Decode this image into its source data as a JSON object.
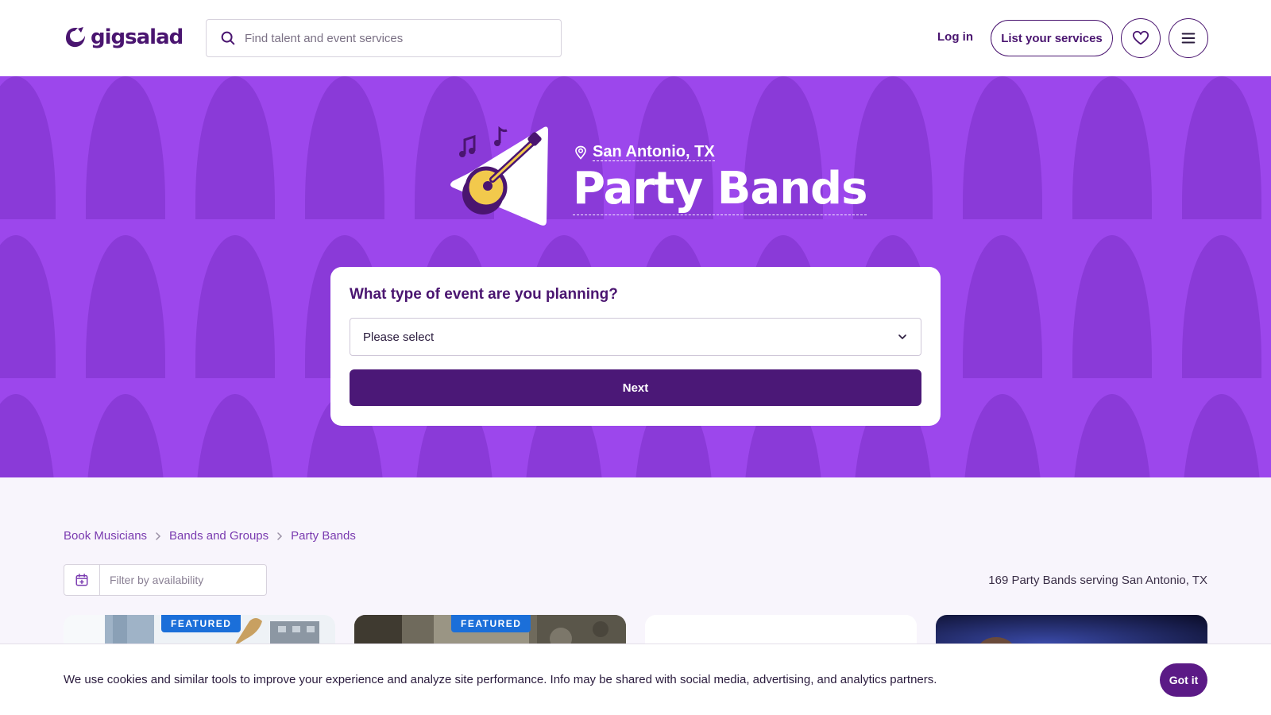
{
  "header": {
    "logo_text": "gigsalad",
    "search_placeholder": "Find talent and event services",
    "login_label": "Log in",
    "list_services_label": "List your services",
    "favorites_icon": "heart-icon",
    "menu_icon": "hamburger-menu-icon"
  },
  "hero": {
    "location": "San Antonio, TX",
    "title": "Party Bands",
    "illustration_icon": "guitar-illustration",
    "background_color": "#9c47ec",
    "event_form": {
      "question": "What type of event are you planning?",
      "select_value": "Please select",
      "next_label": "Next"
    }
  },
  "breadcrumb": [
    "Book Musicians",
    "Bands and Groups",
    "Party Bands"
  ],
  "filter": {
    "placeholder": "Filter by availability"
  },
  "results": {
    "count_text": "169 Party Bands serving San Antonio, TX"
  },
  "cards": [
    {
      "badge": "FEATURED"
    },
    {
      "badge": "FEATURED"
    },
    {
      "badge": ""
    },
    {
      "badge": ""
    }
  ],
  "cookie": {
    "text": "We use cookies and similar tools to improve your experience and analyze site performance. Info may be shared with social media, advertising, and analytics partners.",
    "button_label": "Got it"
  },
  "colors": {
    "brand_dark": "#4a1570",
    "brand_purple": "#9c47ec",
    "featured_blue": "#1b6fd9",
    "link_purple": "#7a3bb0"
  }
}
